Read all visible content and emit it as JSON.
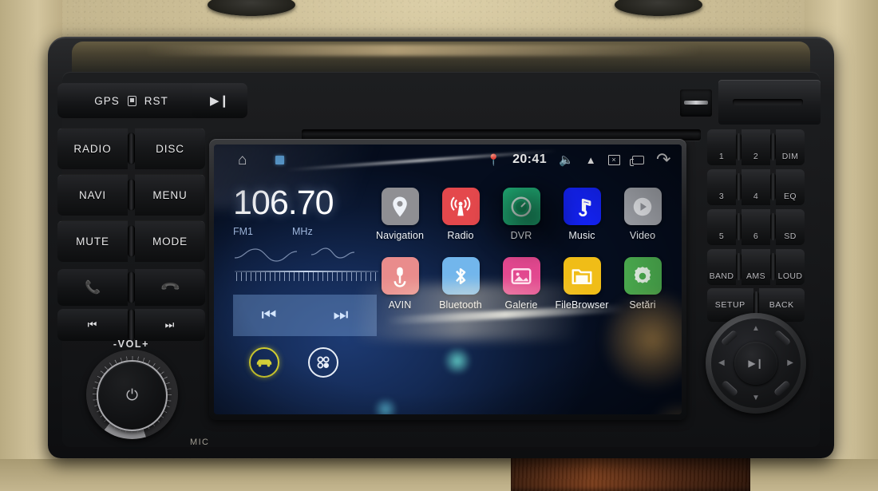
{
  "device": {
    "type": "car-head-unit",
    "mic_label": "MIC",
    "vol_label": "-VOL+"
  },
  "hardware_left": {
    "top_row": {
      "gps": "GPS",
      "rst": "RST",
      "card_icon": "memory-card-icon"
    },
    "playpause": "play-pause-icon",
    "rows": [
      {
        "left": "RADIO",
        "right": "DISC"
      },
      {
        "left": "NAVI",
        "right": "MENU"
      },
      {
        "left": "MUTE",
        "right": "MODE"
      }
    ],
    "call_row": {
      "left": "call-answer-icon",
      "right": "call-end-icon"
    },
    "track_row": {
      "left": "⏮",
      "right": "⏭"
    }
  },
  "hardware_right": {
    "keys": [
      [
        "1",
        "2",
        "DIM"
      ],
      [
        "3",
        "4",
        "EQ"
      ],
      [
        "5",
        "6",
        "SD"
      ],
      [
        "BAND",
        "AMS",
        "LOUD"
      ]
    ],
    "wide_keys": [
      "SETUP",
      "BACK"
    ],
    "dpad": {
      "center": "play-pause-icon",
      "up": "▲",
      "down": "▼",
      "left": "◀",
      "right": "▶"
    }
  },
  "screen": {
    "statusbar": {
      "home": "home-icon",
      "notification": "notification-dot-icon",
      "location": "location-pin-icon",
      "clock": "20:41",
      "volume": "volume-icon",
      "eject": "eject-icon",
      "close_box": "×",
      "recents": "recents-icon",
      "back": "back-icon"
    },
    "radio": {
      "frequency": "106.70",
      "band": "FM1",
      "unit": "MHz",
      "prev_label": "⏮",
      "next_label": "⏭"
    },
    "dock": {
      "car": "car-icon",
      "apps": "app-drawer-icon"
    },
    "apps": [
      [
        {
          "label": "Navigation",
          "icon": "location-pin-icon",
          "color": "#8f8f93"
        },
        {
          "label": "Radio",
          "icon": "radio-waves-icon",
          "color": "#e4484c"
        },
        {
          "label": "DVR",
          "icon": "camera-gauge-icon",
          "color": "#22b47a"
        },
        {
          "label": "Music",
          "icon": "music-note-icon",
          "color": "#1322f0"
        },
        {
          "label": "Video",
          "icon": "play-circle-icon",
          "color": "#a9acb3"
        }
      ],
      [
        {
          "label": "AVIN",
          "icon": "aux-plug-icon",
          "color": "#e98c8c"
        },
        {
          "label": "Bluetooth",
          "icon": "bluetooth-icon",
          "color": "#72b6ec"
        },
        {
          "label": "Galerie",
          "icon": "photo-icon",
          "color": "#e2488f"
        },
        {
          "label": "FileBrowser",
          "icon": "folder-icon",
          "color": "#f0bd17"
        },
        {
          "label": "Setări",
          "icon": "gear-icon",
          "color": "#4caf50"
        }
      ]
    ]
  }
}
